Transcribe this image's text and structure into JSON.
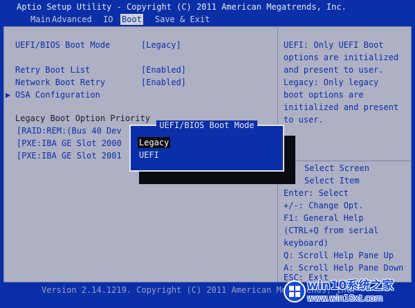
{
  "header": {
    "title": "Aptio Setup Utility - Copyright (C) 2011 American Megatrends, Inc."
  },
  "tabs": [
    {
      "label": "Main"
    },
    {
      "label": "Advanced"
    },
    {
      "label": "IO"
    },
    {
      "label": "Boot",
      "active": true
    },
    {
      "label": "Save & Exit"
    }
  ],
  "settings": {
    "boot_mode_label": "UEFI/BIOS Boot Mode",
    "boot_mode_value": "[Legacy]",
    "retry_boot_label": "Retry Boot List",
    "retry_boot_value": "[Enabled]",
    "network_retry_label": "Network Boot Retry",
    "network_retry_value": "[Enabled]",
    "osa_arrow": "▶",
    "osa_label": "OSA Configuration",
    "legacy_priority_label": "Legacy Boot Option Priority",
    "boot_options": [
      "[RAID:REM:(Bus 40 Dev",
      "[PXE:IBA GE Slot 2000",
      "[PXE:IBA GE Slot 2001"
    ]
  },
  "help": {
    "lines": [
      "UEFI: Only UEFI Boot",
      "options are initialized",
      "and present to user.",
      "Legacy: Only legacy",
      "boot options are",
      "initialized and present",
      "to user."
    ]
  },
  "keys": {
    "lines": [
      "Select Screen",
      "Select Item",
      "Enter: Select",
      "+/-: Change Opt.",
      "F1: General Help",
      "(CTRL+Q from serial",
      "keyboard)",
      "Q: Scroll Help Pane Up",
      "A: Scroll Help Pane Down",
      "ESC: Exit"
    ]
  },
  "popup": {
    "title": "UEFI/BIOS Boot Mode",
    "options": [
      {
        "label": "Legacy",
        "selected": true
      },
      {
        "label": "UEFI",
        "selected": false
      }
    ]
  },
  "footer": {
    "text": "Version 2.14.1219. Copyright (C) 2011 American Megatrends, Inc."
  },
  "watermark": {
    "line1": "win10系统之家",
    "line2": "www.win10xt.com"
  },
  "colors": {
    "bios_blue": "#0a2fa8",
    "panel_gray": "#aeb0c4",
    "popup_text": "#e8e8e8",
    "highlight_black": "#0b0b12"
  }
}
